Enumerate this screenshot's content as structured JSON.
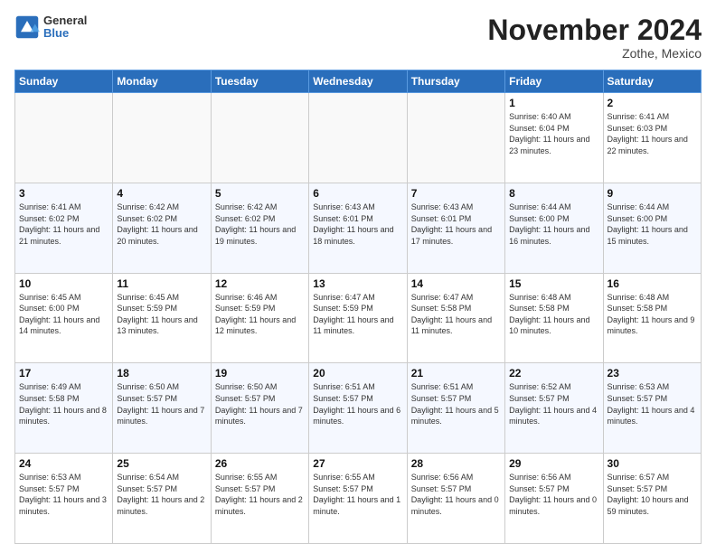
{
  "header": {
    "logo_general": "General",
    "logo_blue": "Blue",
    "month_title": "November 2024",
    "location": "Zothe, Mexico"
  },
  "weekdays": [
    "Sunday",
    "Monday",
    "Tuesday",
    "Wednesday",
    "Thursday",
    "Friday",
    "Saturday"
  ],
  "weeks": [
    [
      {
        "day": "",
        "empty": true
      },
      {
        "day": "",
        "empty": true
      },
      {
        "day": "",
        "empty": true
      },
      {
        "day": "",
        "empty": true
      },
      {
        "day": "",
        "empty": true
      },
      {
        "day": "1",
        "sunrise": "6:40 AM",
        "sunset": "6:04 PM",
        "daylight": "11 hours and 23 minutes."
      },
      {
        "day": "2",
        "sunrise": "6:41 AM",
        "sunset": "6:03 PM",
        "daylight": "11 hours and 22 minutes."
      }
    ],
    [
      {
        "day": "3",
        "sunrise": "6:41 AM",
        "sunset": "6:02 PM",
        "daylight": "11 hours and 21 minutes."
      },
      {
        "day": "4",
        "sunrise": "6:42 AM",
        "sunset": "6:02 PM",
        "daylight": "11 hours and 20 minutes."
      },
      {
        "day": "5",
        "sunrise": "6:42 AM",
        "sunset": "6:02 PM",
        "daylight": "11 hours and 19 minutes."
      },
      {
        "day": "6",
        "sunrise": "6:43 AM",
        "sunset": "6:01 PM",
        "daylight": "11 hours and 18 minutes."
      },
      {
        "day": "7",
        "sunrise": "6:43 AM",
        "sunset": "6:01 PM",
        "daylight": "11 hours and 17 minutes."
      },
      {
        "day": "8",
        "sunrise": "6:44 AM",
        "sunset": "6:00 PM",
        "daylight": "11 hours and 16 minutes."
      },
      {
        "day": "9",
        "sunrise": "6:44 AM",
        "sunset": "6:00 PM",
        "daylight": "11 hours and 15 minutes."
      }
    ],
    [
      {
        "day": "10",
        "sunrise": "6:45 AM",
        "sunset": "6:00 PM",
        "daylight": "11 hours and 14 minutes."
      },
      {
        "day": "11",
        "sunrise": "6:45 AM",
        "sunset": "5:59 PM",
        "daylight": "11 hours and 13 minutes."
      },
      {
        "day": "12",
        "sunrise": "6:46 AM",
        "sunset": "5:59 PM",
        "daylight": "11 hours and 12 minutes."
      },
      {
        "day": "13",
        "sunrise": "6:47 AM",
        "sunset": "5:59 PM",
        "daylight": "11 hours and 11 minutes."
      },
      {
        "day": "14",
        "sunrise": "6:47 AM",
        "sunset": "5:58 PM",
        "daylight": "11 hours and 11 minutes."
      },
      {
        "day": "15",
        "sunrise": "6:48 AM",
        "sunset": "5:58 PM",
        "daylight": "11 hours and 10 minutes."
      },
      {
        "day": "16",
        "sunrise": "6:48 AM",
        "sunset": "5:58 PM",
        "daylight": "11 hours and 9 minutes."
      }
    ],
    [
      {
        "day": "17",
        "sunrise": "6:49 AM",
        "sunset": "5:58 PM",
        "daylight": "11 hours and 8 minutes."
      },
      {
        "day": "18",
        "sunrise": "6:50 AM",
        "sunset": "5:57 PM",
        "daylight": "11 hours and 7 minutes."
      },
      {
        "day": "19",
        "sunrise": "6:50 AM",
        "sunset": "5:57 PM",
        "daylight": "11 hours and 7 minutes."
      },
      {
        "day": "20",
        "sunrise": "6:51 AM",
        "sunset": "5:57 PM",
        "daylight": "11 hours and 6 minutes."
      },
      {
        "day": "21",
        "sunrise": "6:51 AM",
        "sunset": "5:57 PM",
        "daylight": "11 hours and 5 minutes."
      },
      {
        "day": "22",
        "sunrise": "6:52 AM",
        "sunset": "5:57 PM",
        "daylight": "11 hours and 4 minutes."
      },
      {
        "day": "23",
        "sunrise": "6:53 AM",
        "sunset": "5:57 PM",
        "daylight": "11 hours and 4 minutes."
      }
    ],
    [
      {
        "day": "24",
        "sunrise": "6:53 AM",
        "sunset": "5:57 PM",
        "daylight": "11 hours and 3 minutes."
      },
      {
        "day": "25",
        "sunrise": "6:54 AM",
        "sunset": "5:57 PM",
        "daylight": "11 hours and 2 minutes."
      },
      {
        "day": "26",
        "sunrise": "6:55 AM",
        "sunset": "5:57 PM",
        "daylight": "11 hours and 2 minutes."
      },
      {
        "day": "27",
        "sunrise": "6:55 AM",
        "sunset": "5:57 PM",
        "daylight": "11 hours and 1 minute."
      },
      {
        "day": "28",
        "sunrise": "6:56 AM",
        "sunset": "5:57 PM",
        "daylight": "11 hours and 0 minutes."
      },
      {
        "day": "29",
        "sunrise": "6:56 AM",
        "sunset": "5:57 PM",
        "daylight": "11 hours and 0 minutes."
      },
      {
        "day": "30",
        "sunrise": "6:57 AM",
        "sunset": "5:57 PM",
        "daylight": "10 hours and 59 minutes."
      }
    ]
  ]
}
